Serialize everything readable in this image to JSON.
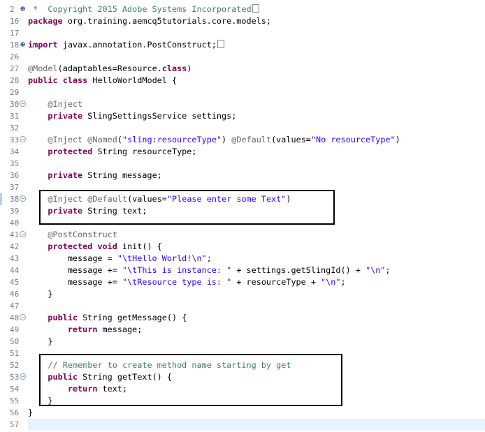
{
  "gutter": [
    {
      "n": "2",
      "fold": "plus"
    },
    {
      "n": "16",
      "fold": ""
    },
    {
      "n": "17",
      "fold": ""
    },
    {
      "n": "18",
      "fold": "plus"
    },
    {
      "n": "26",
      "fold": ""
    },
    {
      "n": "27",
      "fold": ""
    },
    {
      "n": "28",
      "fold": ""
    },
    {
      "n": "29",
      "fold": ""
    },
    {
      "n": "30",
      "fold": "minus"
    },
    {
      "n": "31",
      "fold": ""
    },
    {
      "n": "32",
      "fold": ""
    },
    {
      "n": "33",
      "fold": "minus"
    },
    {
      "n": "34",
      "fold": ""
    },
    {
      "n": "35",
      "fold": ""
    },
    {
      "n": "36",
      "fold": ""
    },
    {
      "n": "37",
      "fold": ""
    },
    {
      "n": "38",
      "fold": "minus",
      "marker": true
    },
    {
      "n": "39",
      "fold": ""
    },
    {
      "n": "40",
      "fold": ""
    },
    {
      "n": "41",
      "fold": "minus"
    },
    {
      "n": "42",
      "fold": ""
    },
    {
      "n": "43",
      "fold": ""
    },
    {
      "n": "44",
      "fold": ""
    },
    {
      "n": "45",
      "fold": ""
    },
    {
      "n": "46",
      "fold": ""
    },
    {
      "n": "47",
      "fold": ""
    },
    {
      "n": "48",
      "fold": "minus"
    },
    {
      "n": "49",
      "fold": ""
    },
    {
      "n": "50",
      "fold": ""
    },
    {
      "n": "51",
      "fold": ""
    },
    {
      "n": "52",
      "fold": ""
    },
    {
      "n": "53",
      "fold": "minus"
    },
    {
      "n": "54",
      "fold": ""
    },
    {
      "n": "55",
      "fold": ""
    },
    {
      "n": "56",
      "fold": ""
    },
    {
      "n": "57",
      "fold": ""
    }
  ],
  "lines": [
    [
      {
        "t": " *  Copyright 2015 Adobe Systems Incorporated",
        "c": "cmt"
      },
      {
        "box": true
      }
    ],
    [
      {
        "t": "package",
        "c": "kw"
      },
      {
        "t": " org.training.aemcq5tutorials.core.models;"
      }
    ],
    [],
    [
      {
        "t": "import",
        "c": "kw"
      },
      {
        "t": " javax.annotation.PostConstruct;"
      },
      {
        "box": true
      }
    ],
    [],
    [
      {
        "t": "@Model",
        "c": "ann"
      },
      {
        "t": "(adaptables=Resource."
      },
      {
        "t": "class",
        "c": "kw"
      },
      {
        "t": ")"
      }
    ],
    [
      {
        "t": "public",
        "c": "kw"
      },
      {
        "t": " "
      },
      {
        "t": "class",
        "c": "kw"
      },
      {
        "t": " HelloWorldModel {"
      }
    ],
    [],
    [
      {
        "t": "    "
      },
      {
        "t": "@Inject",
        "c": "ann"
      }
    ],
    [
      {
        "t": "    "
      },
      {
        "t": "private",
        "c": "kw"
      },
      {
        "t": " SlingSettingsService settings;"
      }
    ],
    [],
    [
      {
        "t": "    "
      },
      {
        "t": "@Inject",
        "c": "ann"
      },
      {
        "t": " "
      },
      {
        "t": "@Named",
        "c": "ann"
      },
      {
        "t": "("
      },
      {
        "t": "\"sling:resourceType\"",
        "c": "str"
      },
      {
        "t": ") "
      },
      {
        "t": "@Default",
        "c": "ann"
      },
      {
        "t": "(values="
      },
      {
        "t": "\"No resourceType\"",
        "c": "str"
      },
      {
        "t": ")"
      }
    ],
    [
      {
        "t": "    "
      },
      {
        "t": "protected",
        "c": "kw"
      },
      {
        "t": " String resourceType;"
      }
    ],
    [],
    [
      {
        "t": "    "
      },
      {
        "t": "private",
        "c": "kw"
      },
      {
        "t": " String message;"
      }
    ],
    [],
    [
      {
        "t": "    "
      },
      {
        "t": "@Inject",
        "c": "ann"
      },
      {
        "t": " "
      },
      {
        "t": "@Default",
        "c": "ann"
      },
      {
        "t": "(values="
      },
      {
        "t": "\"Please enter some Text\"",
        "c": "str"
      },
      {
        "t": ")"
      }
    ],
    [
      {
        "t": "    "
      },
      {
        "t": "private",
        "c": "kw"
      },
      {
        "t": " String text;"
      }
    ],
    [],
    [
      {
        "t": "    "
      },
      {
        "t": "@PostConstruct",
        "c": "ann"
      }
    ],
    [
      {
        "t": "    "
      },
      {
        "t": "protected",
        "c": "kw"
      },
      {
        "t": " "
      },
      {
        "t": "void",
        "c": "kw"
      },
      {
        "t": " init() {"
      }
    ],
    [
      {
        "t": "        message = "
      },
      {
        "t": "\"\\tHello World!\\n\"",
        "c": "str"
      },
      {
        "t": ";"
      }
    ],
    [
      {
        "t": "        message += "
      },
      {
        "t": "\"\\tThis is instance: \"",
        "c": "str"
      },
      {
        "t": " + settings.getSlingId() + "
      },
      {
        "t": "\"\\n\"",
        "c": "str"
      },
      {
        "t": ";"
      }
    ],
    [
      {
        "t": "        message += "
      },
      {
        "t": "\"\\tResource type is: \"",
        "c": "str"
      },
      {
        "t": " + resourceType + "
      },
      {
        "t": "\"\\n\"",
        "c": "str"
      },
      {
        "t": ";"
      }
    ],
    [
      {
        "t": "    }"
      }
    ],
    [],
    [
      {
        "t": "    "
      },
      {
        "t": "public",
        "c": "kw"
      },
      {
        "t": " String getMessage() {"
      }
    ],
    [
      {
        "t": "        "
      },
      {
        "t": "return",
        "c": "kw"
      },
      {
        "t": " message;"
      }
    ],
    [
      {
        "t": "    }"
      }
    ],
    [],
    [
      {
        "t": "    "
      },
      {
        "t": "// Remember to create method name starting by get",
        "c": "cmt"
      }
    ],
    [
      {
        "t": "    "
      },
      {
        "t": "public",
        "c": "kw"
      },
      {
        "t": " String getText() {"
      }
    ],
    [
      {
        "t": "        "
      },
      {
        "t": "return",
        "c": "kw"
      },
      {
        "t": " text;"
      }
    ],
    [
      {
        "t": "    }"
      }
    ],
    [
      {
        "t": "}"
      }
    ],
    []
  ]
}
